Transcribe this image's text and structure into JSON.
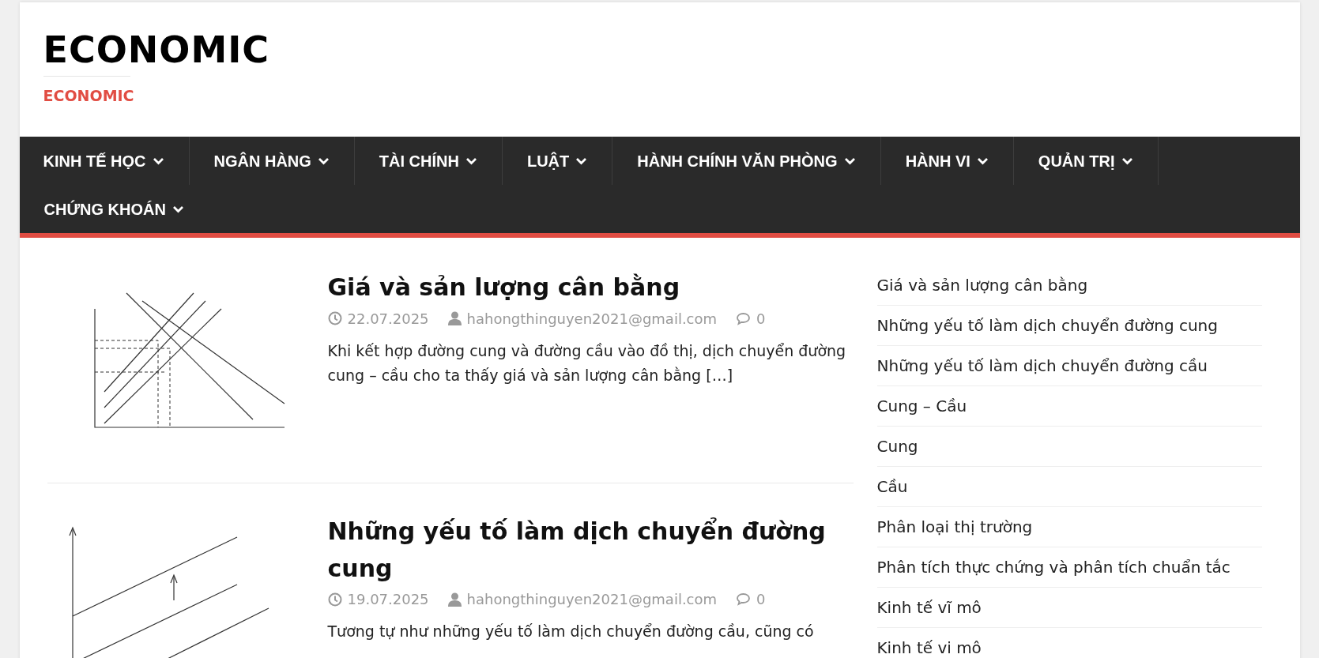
{
  "site": {
    "title": "ECONOMIC",
    "tagline": "ECONOMIC"
  },
  "nav": [
    {
      "label": "KINH TẾ HỌC"
    },
    {
      "label": "NGÂN HÀNG"
    },
    {
      "label": "TÀI CHÍNH"
    },
    {
      "label": "LUẬT"
    },
    {
      "label": "HÀNH CHÍNH VĂN PHÒNG"
    },
    {
      "label": "HÀNH VI"
    },
    {
      "label": "QUẢN TRỊ"
    },
    {
      "label": "CHỨNG KHOÁN"
    }
  ],
  "posts": [
    {
      "title": "Giá và sản lượng cân bằng",
      "date": "22.07.2025",
      "author": "hahongthinguyen2021@gmail.com",
      "comments": "0",
      "excerpt": "Khi kết hợp đường cung và đường cầu vào đồ thị, dịch chuyển đường cung – cầu cho ta thấy giá và sản lượng cân bằng […]",
      "kind": "equilibrium"
    },
    {
      "title": "Những yếu tố làm dịch chuyển đường cung",
      "date": "19.07.2025",
      "author": "hahongthinguyen2021@gmail.com",
      "comments": "0",
      "excerpt": "Tương tự như những yếu tố làm dịch chuyển đường cầu, cũng có",
      "kind": "shift"
    }
  ],
  "sidebar": {
    "items": [
      "Giá và sản lượng cân bằng",
      "Những yếu tố làm dịch chuyển đường cung",
      "Những yếu tố làm dịch chuyển đường cầu",
      "Cung – Cầu",
      "Cung",
      "Cầu",
      "Phân loại thị trường",
      "Phân tích thực chứng và phân tích chuẩn tắc",
      "Kinh tế vĩ mô",
      "Kinh tế vi mô"
    ]
  }
}
